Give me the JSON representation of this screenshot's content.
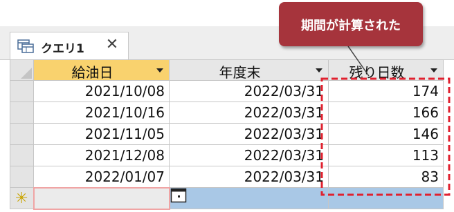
{
  "tab": {
    "label": "クエリ1",
    "close_glyph": "✕"
  },
  "columns": [
    {
      "label": "給油日",
      "selected": true
    },
    {
      "label": "年度末",
      "selected": false
    },
    {
      "label": "残り日数",
      "selected": false
    }
  ],
  "rows": [
    {
      "date": "2021/10/08",
      "year_end": "2022/03/31",
      "days": "174"
    },
    {
      "date": "2021/10/16",
      "year_end": "2022/03/31",
      "days": "166"
    },
    {
      "date": "2021/11/05",
      "year_end": "2022/03/31",
      "days": "146"
    },
    {
      "date": "2021/12/08",
      "year_end": "2022/03/31",
      "days": "113"
    },
    {
      "date": "2022/01/07",
      "year_end": "2022/03/31",
      "days": "83"
    }
  ],
  "new_row": {
    "marker": "✳"
  },
  "callout": {
    "text": "期間が計算された"
  },
  "colors": {
    "selected_header": "#f9d26e",
    "callout_bg": "#a6343c",
    "highlight_border": "#e0212f",
    "new_row_blue": "#a9c8e6"
  },
  "icons": {
    "tab": "query-datasheet-icon",
    "close": "close-icon",
    "dropdown": "chevron-down-icon",
    "calendar": "calendar-icon",
    "new_record": "new-record-asterisk-icon",
    "select_all": "select-all-corner-icon"
  }
}
